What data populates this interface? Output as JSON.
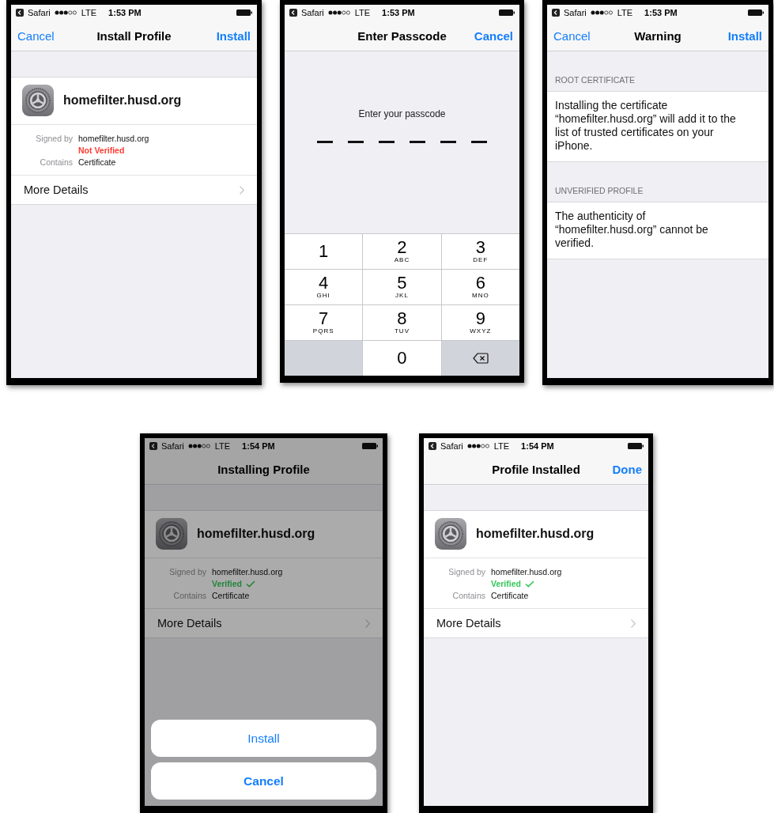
{
  "phones": [
    {
      "kind": "profile",
      "status_bar": {
        "app": "Safari",
        "network": "LTE",
        "time": "1:53 PM"
      },
      "nav": {
        "left": "Cancel",
        "title": "Install Profile",
        "right": "Install"
      },
      "profile": {
        "name": "homefilter.husd.org",
        "signed_by_label": "Signed by",
        "signed_by": "homefilter.husd.org",
        "verified": false,
        "verification": "Not Verified",
        "contains_label": "Contains",
        "contains": "Certificate",
        "more": "More Details"
      },
      "dimmed": false
    },
    {
      "kind": "passcode",
      "status_bar": {
        "app": "Safari",
        "network": "LTE",
        "time": "1:53 PM"
      },
      "nav": {
        "title": "Enter Passcode",
        "right": "Cancel"
      },
      "prompt": "Enter your passcode",
      "slots": [
        {
          "filled": false
        },
        {
          "filled": false
        },
        {
          "filled": false
        },
        {
          "filled": false
        },
        {
          "filled": false
        },
        {
          "filled": false
        }
      ],
      "keys": [
        {
          "kind": "digit",
          "digit": "1"
        },
        {
          "kind": "digit",
          "digit": "2",
          "letters": "ABC"
        },
        {
          "kind": "digit",
          "digit": "3",
          "letters": "DEF"
        },
        {
          "kind": "digit",
          "digit": "4",
          "letters": "GHI"
        },
        {
          "kind": "digit",
          "digit": "5",
          "letters": "JKL"
        },
        {
          "kind": "digit",
          "digit": "6",
          "letters": "MNO"
        },
        {
          "kind": "digit",
          "digit": "7",
          "letters": "PQRS"
        },
        {
          "kind": "digit",
          "digit": "8",
          "letters": "TUV"
        },
        {
          "kind": "digit",
          "digit": "9",
          "letters": "WXYZ"
        },
        {
          "kind": "blank"
        },
        {
          "kind": "digit",
          "digit": "0"
        },
        {
          "kind": "delete"
        }
      ]
    },
    {
      "kind": "warning",
      "status_bar": {
        "app": "Safari",
        "network": "LTE",
        "time": "1:53 PM"
      },
      "nav": {
        "left": "Cancel",
        "title": "Warning",
        "right": "Install"
      },
      "sections": [
        {
          "header": "ROOT CERTIFICATE",
          "body": "Installing the certificate “homefilter.husd.org” will add it to the list of trusted certificates on your iPhone."
        },
        {
          "header": "UNVERIFIED PROFILE",
          "body": "The authenticity of “homefilter.husd.org” cannot be verified."
        }
      ]
    },
    {
      "kind": "profile",
      "status_bar": {
        "app": "Safari",
        "network": "LTE",
        "time": "1:54 PM"
      },
      "nav": {
        "title": "Installing Profile"
      },
      "profile": {
        "name": "homefilter.husd.org",
        "signed_by_label": "Signed by",
        "signed_by": "homefilter.husd.org",
        "verified": true,
        "verification": "Verified",
        "contains_label": "Contains",
        "contains": "Certificate",
        "more": "More Details"
      },
      "dimmed": true,
      "action_sheet": [
        {
          "kind": "default",
          "label": "Install"
        },
        {
          "kind": "cancel",
          "label": "Cancel"
        }
      ]
    },
    {
      "kind": "profile",
      "status_bar": {
        "app": "Safari",
        "network": "LTE",
        "time": "1:54 PM"
      },
      "nav": {
        "title": "Profile Installed",
        "right": "Done"
      },
      "profile": {
        "name": "homefilter.husd.org",
        "signed_by_label": "Signed by",
        "signed_by": "homefilter.husd.org",
        "verified": true,
        "verification": "Verified",
        "contains_label": "Contains",
        "contains": "Certificate",
        "more": "More Details"
      },
      "dimmed": false
    }
  ]
}
